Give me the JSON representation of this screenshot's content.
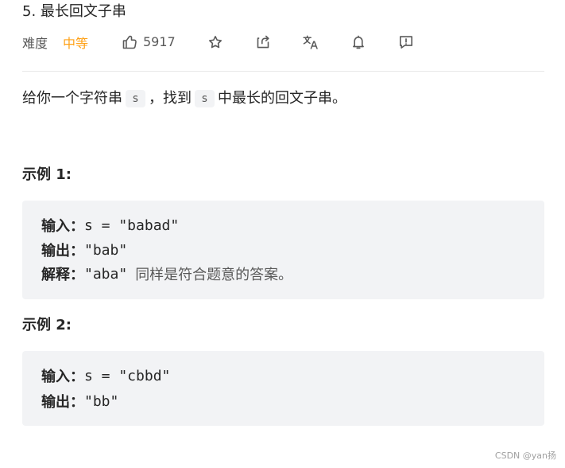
{
  "problem": {
    "title": "5. 最长回文子串",
    "difficulty_label": "难度",
    "difficulty_value": "中等",
    "likes": "5917"
  },
  "toolbar": {
    "icons": {
      "like": "thumb-up-icon",
      "star": "star-icon",
      "share": "share-icon",
      "translate": "translate-icon",
      "bell": "bell-icon",
      "feedback": "feedback-icon"
    }
  },
  "description": {
    "prefix": "给你一个字符串",
    "code_s_1": "s",
    "middle": "，找到",
    "code_s_2": "s",
    "suffix": "中最长的回文子串。"
  },
  "examples": [
    {
      "title": "示例 1:",
      "input_label": "输入：",
      "input_value": "s = \"babad\"",
      "output_label": "输出：",
      "output_value": "\"bab\"",
      "explanation_label": "解释：",
      "explanation_value": "\"aba\"",
      "explanation_note": "同样是符合题意的答案。"
    },
    {
      "title": "示例 2:",
      "input_label": "输入：",
      "input_value": "s = \"cbbd\"",
      "output_label": "输出：",
      "output_value": "\"bb\""
    }
  ],
  "watermark": "CSDN @yan扬",
  "colors": {
    "difficulty_medium": "#ffa116",
    "text_primary": "#262626",
    "text_secondary": "#595959",
    "code_background": "#f2f3f5",
    "divider": "#e8e8e8",
    "watermark": "#a0a0a0"
  }
}
